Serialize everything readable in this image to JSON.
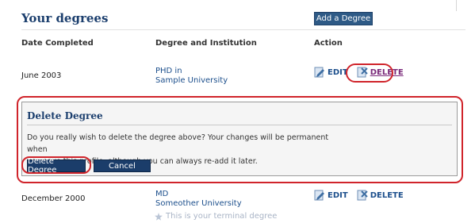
{
  "section": {
    "title": "Your degrees",
    "add_button": "Add a Degree"
  },
  "columns": {
    "date": "Date Completed",
    "degree": "Degree and Institution",
    "action": "Action"
  },
  "actions": {
    "edit": "EDIT",
    "delete": "DELETE"
  },
  "degrees": [
    {
      "date": "June 2003",
      "degree": "PHD in",
      "institution": "Sample University"
    },
    {
      "date": "December 2000",
      "degree": "MD",
      "institution": "Someother University"
    }
  ],
  "dialog": {
    "title": "Delete Degree",
    "message_line1": "Do you really wish to delete the degree above? Your changes will be permanent when",
    "message_line2": "you save this profile, although you can always re-add it later.",
    "confirm_button": "Delete Degree",
    "cancel_button": "Cancel"
  },
  "terminal_note": "This is your terminal degree",
  "colors": {
    "accent": "#1c3f6e",
    "link": "#1c4f8c",
    "button": "#1b3d6a",
    "highlight": "#d0242b"
  },
  "icons": {
    "edit": "pencil-icon",
    "delete": "delete-icon"
  }
}
